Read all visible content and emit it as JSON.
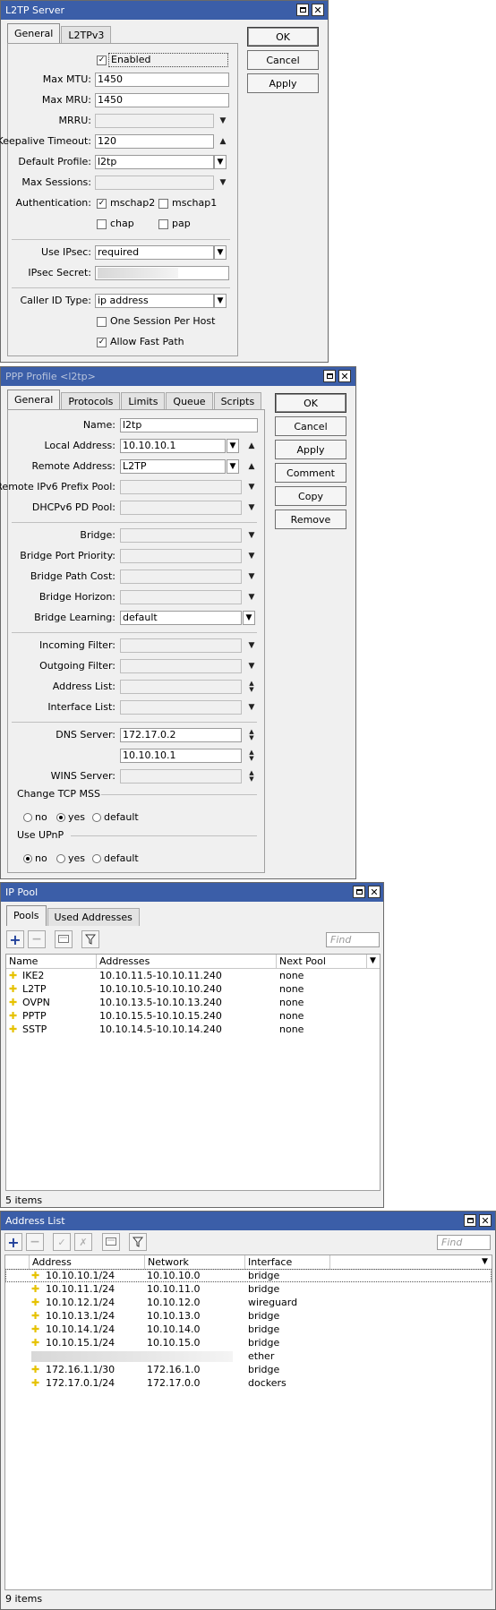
{
  "l2tp_server": {
    "title": "L2TP Server",
    "tabs": [
      "General",
      "L2TPv3"
    ],
    "buttons": {
      "ok": "OK",
      "cancel": "Cancel",
      "apply": "Apply"
    },
    "enabled_label": "Enabled",
    "enabled": true,
    "max_mtu_label": "Max MTU:",
    "max_mtu": "1450",
    "max_mru_label": "Max MRU:",
    "max_mru": "1450",
    "mrru_label": "MRRU:",
    "mrru": "",
    "keepalive_label": "Keepalive Timeout:",
    "keepalive": "120",
    "default_profile_label": "Default Profile:",
    "default_profile": "l2tp",
    "max_sessions_label": "Max Sessions:",
    "max_sessions": "",
    "auth_label": "Authentication:",
    "auth": {
      "mschap2": "mschap2",
      "mschap1": "mschap1",
      "chap": "chap",
      "pap": "pap"
    },
    "auth_checked": {
      "mschap2": true,
      "mschap1": false,
      "chap": false,
      "pap": false
    },
    "use_ipsec_label": "Use IPsec:",
    "use_ipsec": "required",
    "ipsec_secret_label": "IPsec Secret:",
    "caller_id_label": "Caller ID Type:",
    "caller_id": "ip address",
    "one_session_label": "One Session Per Host",
    "one_session": false,
    "allow_fast_path_label": "Allow Fast Path",
    "allow_fast_path": true
  },
  "ppp_profile": {
    "title": "PPP Profile <l2tp>",
    "tabs": [
      "General",
      "Protocols",
      "Limits",
      "Queue",
      "Scripts"
    ],
    "buttons": {
      "ok": "OK",
      "cancel": "Cancel",
      "apply": "Apply",
      "comment": "Comment",
      "copy": "Copy",
      "remove": "Remove"
    },
    "fields": {
      "name": {
        "label": "Name:",
        "value": "l2tp"
      },
      "local_address": {
        "label": "Local Address:",
        "value": "10.10.10.1"
      },
      "remote_address": {
        "label": "Remote Address:",
        "value": "L2TP"
      },
      "remote_ipv6_prefix_pool": {
        "label": "Remote IPv6 Prefix Pool:",
        "value": ""
      },
      "dhcpv6_pd_pool": {
        "label": "DHCPv6 PD Pool:",
        "value": ""
      },
      "bridge": {
        "label": "Bridge:",
        "value": ""
      },
      "bridge_port_priority": {
        "label": "Bridge Port Priority:",
        "value": ""
      },
      "bridge_path_cost": {
        "label": "Bridge Path Cost:",
        "value": ""
      },
      "bridge_horizon": {
        "label": "Bridge Horizon:",
        "value": ""
      },
      "bridge_learning": {
        "label": "Bridge Learning:",
        "value": "default"
      },
      "incoming_filter": {
        "label": "Incoming Filter:",
        "value": ""
      },
      "outgoing_filter": {
        "label": "Outgoing Filter:",
        "value": ""
      },
      "address_list": {
        "label": "Address List:",
        "value": ""
      },
      "interface_list": {
        "label": "Interface List:",
        "value": ""
      },
      "dns_server": {
        "label": "DNS Server:",
        "value": "172.17.0.2",
        "value2": "10.10.10.1"
      },
      "wins_server": {
        "label": "WINS Server:",
        "value": ""
      }
    },
    "change_tcp_mss": {
      "label": "Change TCP MSS",
      "options": [
        "no",
        "yes",
        "default"
      ],
      "selected": "yes"
    },
    "use_upnp": {
      "label": "Use UPnP",
      "options": [
        "no",
        "yes",
        "default"
      ],
      "selected": "no"
    }
  },
  "ip_pool": {
    "title": "IP Pool",
    "tabs": [
      "Pools",
      "Used Addresses"
    ],
    "find_placeholder": "Find",
    "columns": [
      "Name",
      "Addresses",
      "Next Pool"
    ],
    "rows": [
      {
        "name": "IKE2",
        "addresses": "10.10.11.5-10.10.11.240",
        "next": "none"
      },
      {
        "name": "L2TP",
        "addresses": "10.10.10.5-10.10.10.240",
        "next": "none"
      },
      {
        "name": "OVPN",
        "addresses": "10.10.13.5-10.10.13.240",
        "next": "none"
      },
      {
        "name": "PPTP",
        "addresses": "10.10.15.5-10.10.15.240",
        "next": "none"
      },
      {
        "name": "SSTP",
        "addresses": "10.10.14.5-10.10.14.240",
        "next": "none"
      }
    ],
    "status": "5 items"
  },
  "address_list": {
    "title": "Address List",
    "find_placeholder": "Find",
    "columns": [
      "Address",
      "Network",
      "Interface"
    ],
    "rows": [
      {
        "address": "10.10.10.1/24",
        "network": "10.10.10.0",
        "interface": "bridge",
        "icon": true
      },
      {
        "address": "10.10.11.1/24",
        "network": "10.10.11.0",
        "interface": "bridge",
        "icon": true
      },
      {
        "address": "10.10.12.1/24",
        "network": "10.10.12.0",
        "interface": "wireguard",
        "icon": true
      },
      {
        "address": "10.10.13.1/24",
        "network": "10.10.13.0",
        "interface": "bridge",
        "icon": true
      },
      {
        "address": "10.10.14.1/24",
        "network": "10.10.14.0",
        "interface": "bridge",
        "icon": true
      },
      {
        "address": "10.10.15.1/24",
        "network": "10.10.15.0",
        "interface": "bridge",
        "icon": true
      },
      {
        "address": "",
        "network": "",
        "interface": "ether",
        "icon": false,
        "blurred": true
      },
      {
        "address": "172.16.1.1/30",
        "network": "172.16.1.0",
        "interface": "bridge",
        "icon": true
      },
      {
        "address": "172.17.0.1/24",
        "network": "172.17.0.0",
        "interface": "dockers",
        "icon": true
      }
    ],
    "status": "9 items"
  },
  "colors": {
    "titlebar": "#3b5ea8",
    "window_bg": "#f0f0f0",
    "plus_icon": "#1f3f99",
    "row_icon": "#e6c200"
  }
}
